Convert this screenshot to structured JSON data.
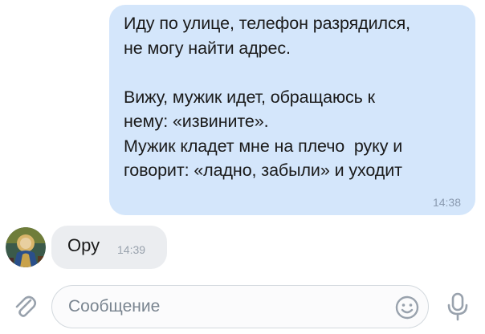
{
  "messages": {
    "outgoing": {
      "text": "Иду по улице, телефон разрядился,\nне могу найти адрес.\n\nВижу, мужик идет, обращаюсь к\nнему: «извините».\nМужик кладет мне на плечо  руку и\nговорит: «ладно, забыли» и уходит",
      "time": "14:38"
    },
    "incoming": {
      "text": "Ору",
      "time": "14:39"
    }
  },
  "composer": {
    "placeholder": "Сообщение",
    "attach_icon": "paperclip-icon",
    "emoji_icon": "smiley-icon",
    "mic_icon": "microphone-icon"
  },
  "colors": {
    "outgoing_bubble": "#d4e6fb",
    "incoming_bubble": "#ebedf0",
    "icon_gray": "#99a2ad"
  }
}
